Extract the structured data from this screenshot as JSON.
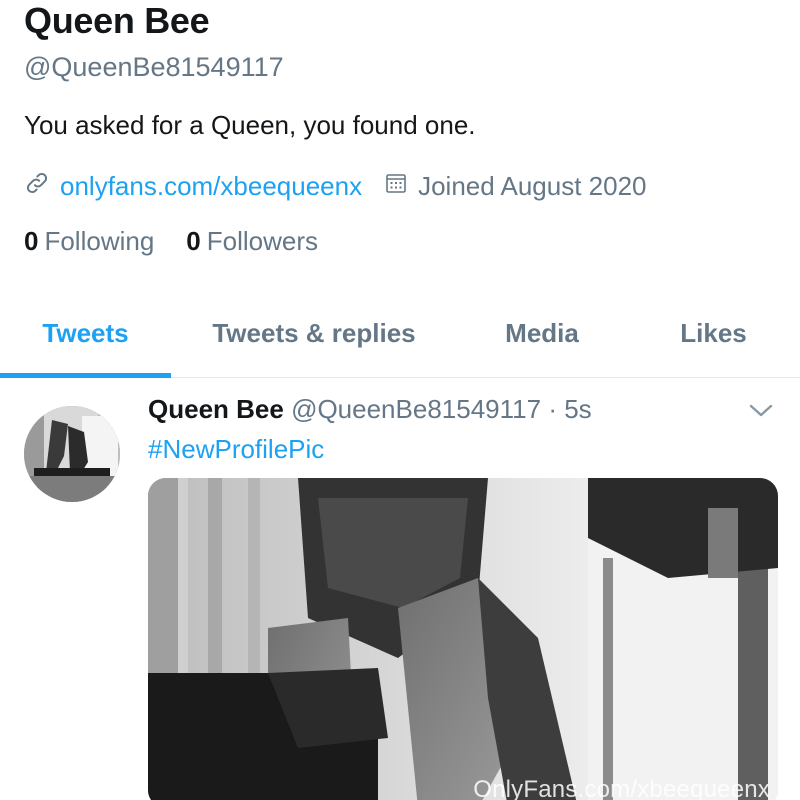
{
  "profile": {
    "name": "Queen Bee",
    "handle": "@QueenBe81549117",
    "bio": "You asked for a Queen, you found one.",
    "website": "onlyfans.com/xbeequeenx",
    "joined": "Joined August 2020",
    "following_count": "0",
    "following_label": "Following",
    "followers_count": "0",
    "followers_label": "Followers",
    "icons": {
      "link": "link-icon",
      "calendar": "calendar-icon"
    }
  },
  "tabs": [
    {
      "label": "Tweets",
      "active": true
    },
    {
      "label": "Tweets & replies",
      "active": false
    },
    {
      "label": "Media",
      "active": false
    },
    {
      "label": "Likes",
      "active": false
    }
  ],
  "tweet": {
    "author": "Queen Bee",
    "handle": "@QueenBe81549117",
    "separator": "·",
    "time": "5s",
    "text": "#NewProfilePic",
    "media_watermark": "OnlyFans.com/xbeequeenx"
  },
  "colors": {
    "accent": "#1da1f2",
    "secondary_text": "#657786",
    "primary_text": "#14171a",
    "divider": "#e1e8ed"
  }
}
